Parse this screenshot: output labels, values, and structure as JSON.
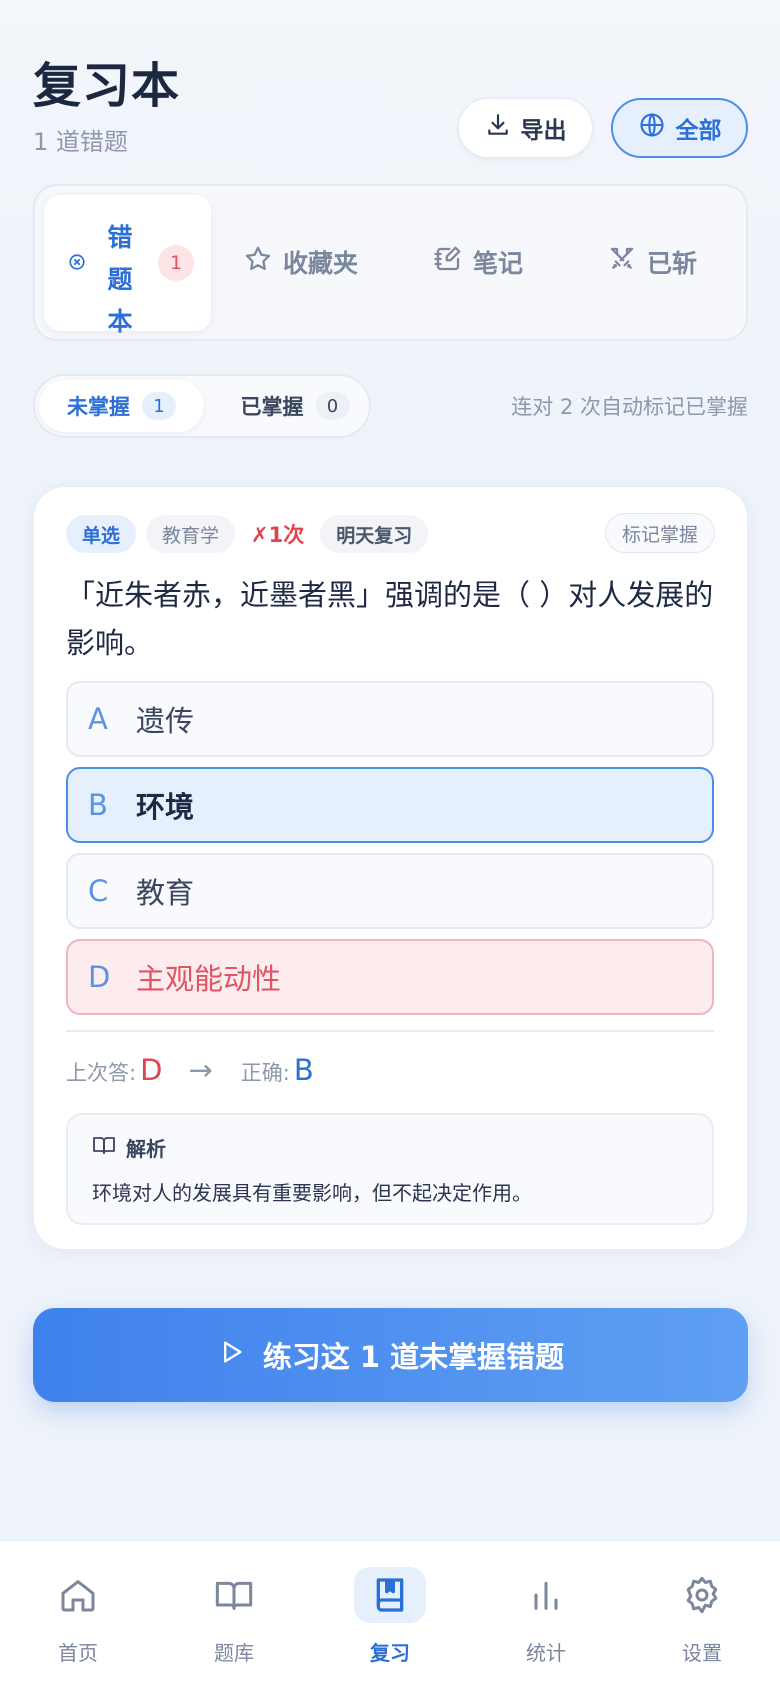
{
  "header": {
    "title": "复习本",
    "subtitle": "1 道错题",
    "export_label": "导出",
    "filter_label": "全部"
  },
  "tabs": {
    "wrong_label": "错题本",
    "wrong_count": "1",
    "favorites_label": "收藏夹",
    "notes_label": "笔记",
    "slain_label": "已斩"
  },
  "segment": {
    "unmastered_label": "未掌握",
    "unmastered_count": "1",
    "mastered_label": "已掌握",
    "mastered_count": "0",
    "hint": "连对 2 次自动标记已掌握"
  },
  "question_card": {
    "type": "单选",
    "subject": "教育学",
    "wrong_times": "✗1次",
    "review": "明天复习",
    "mark_label": "标记掌握",
    "question": "「近朱者赤，近墨者黑」强调的是（ ）对人发展的影响。",
    "options": [
      {
        "letter": "A",
        "text": "遗传"
      },
      {
        "letter": "B",
        "text": "环境"
      },
      {
        "letter": "C",
        "text": "教育"
      },
      {
        "letter": "D",
        "text": "主观能动性"
      }
    ],
    "last_answer_label": "上次答:",
    "last_answer": "D",
    "arrow": "→",
    "correct_label": "正确:",
    "correct_answer": "B",
    "analysis_title": "解析",
    "analysis_text": "环境对人的发展具有重要影响，但不起决定作用。"
  },
  "cta": {
    "label": "练习这 1 道未掌握错题"
  },
  "nav": {
    "items": [
      {
        "label": "首页",
        "icon": "home-icon"
      },
      {
        "label": "题库",
        "icon": "book-open-icon"
      },
      {
        "label": "复习",
        "icon": "bookmark-book-icon"
      },
      {
        "label": "统计",
        "icon": "bar-chart-icon"
      },
      {
        "label": "设置",
        "icon": "gear-icon"
      }
    ]
  },
  "colors": {
    "accent": "#2c6fd6",
    "danger": "#e05565",
    "background": "#eef3fa"
  }
}
